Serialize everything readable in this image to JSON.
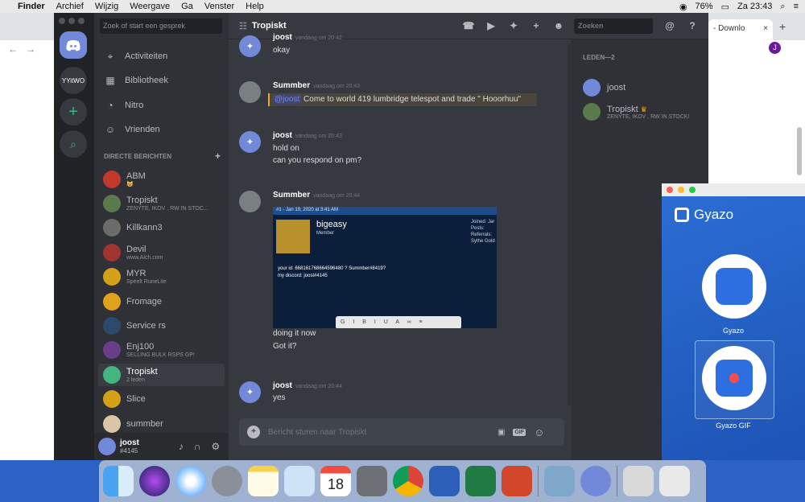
{
  "menubar": {
    "app": "Finder",
    "items": [
      "Archief",
      "Wijzig",
      "Weergave",
      "Ga",
      "Venster",
      "Help"
    ],
    "battery": "76%",
    "clock": "Za 23:43"
  },
  "browser": {
    "tab_label": "- Downlo",
    "new_tab": "+",
    "close": "×",
    "profile_initial": "J"
  },
  "discord": {
    "server_list": {
      "yvtwo_label": "YYitWO",
      "add": "+"
    },
    "search_placeholder": "Zoek of start een gesprek",
    "nav": [
      "Activiteiten",
      "Bibliotheek",
      "Nitro",
      "Vrienden"
    ],
    "dm_header": "DIRECTE BERICHTEN",
    "dm_add": "+",
    "dms": [
      {
        "name": "ABM",
        "sub": "😺",
        "color": "#c0392b"
      },
      {
        "name": "Tropiskt",
        "sub": "ZENYTE, IKOV , RW IN STOC...",
        "color": "#5a7a4e"
      },
      {
        "name": "Killkann3",
        "sub": "",
        "color": "#6b6b6b"
      },
      {
        "name": "Devil",
        "sub": "www.Alch.com",
        "color": "#a0342e"
      },
      {
        "name": "MYR",
        "sub": "Speelt RuneLite",
        "color": "#d4a017"
      },
      {
        "name": "Fromage",
        "sub": "",
        "color": "#e0a11b"
      },
      {
        "name": "Service rs",
        "sub": "",
        "color": "#2d4a6b"
      },
      {
        "name": "Enj100",
        "sub": "SELLING BULK RSPS GP!",
        "color": "#6a3d8a"
      },
      {
        "name": "Tropiskt",
        "sub": "2 leden",
        "color": "#43b581",
        "selected": true
      },
      {
        "name": "Slice",
        "sub": "",
        "color": "#d4a017"
      },
      {
        "name": "summber",
        "sub": "",
        "color": "#d9c6a5"
      }
    ],
    "user": {
      "name": "joost",
      "tag": "#4145"
    },
    "channel": {
      "title": "Tropiskt",
      "search_placeholder": "Zoeken"
    },
    "messages": [
      {
        "author": "joost",
        "time": "vandaag om 20:42",
        "lines": [
          "okay"
        ]
      },
      {
        "author": "Summber",
        "time": "vandaag om 20:43",
        "mention": "@joost",
        "mention_text": " Come to world 419 lumbridge telespot and trade \" Hooorhuu\""
      },
      {
        "author": "joost",
        "time": "vandaag om 20:43",
        "lines": [
          "hold on",
          "can you respond on pm?"
        ]
      },
      {
        "author": "Summber",
        "time": "vandaag om 20:44",
        "after_image": [
          "doing it now",
          "Got it?"
        ]
      },
      {
        "author": "joost",
        "time": "vandaag om 20:44",
        "lines": [
          "yes"
        ]
      }
    ],
    "embed": {
      "post_meta": "#1 - Jan 19, 2020 at 3:41 AM",
      "username": "bigeasy",
      "role": "Member",
      "stats": [
        "Joined: Jar",
        "Posts:",
        "Referrals:",
        "Sythe Gold"
      ],
      "line1": "your id: 668161768664596480 ? Summber#8419?",
      "line2": "my discord: joost#4145"
    },
    "compose_placeholder": "Bericht sturen naar Tropiskt",
    "compose_gif": "GIF",
    "members_header": "LEDEN—2",
    "members": [
      {
        "name": "joost",
        "sub": ""
      },
      {
        "name": "Tropiskt",
        "sub": "ZENYTE, IKOV , RW IN STOCK!"
      }
    ]
  },
  "gyazo": {
    "title": "Gyazo",
    "apps": [
      "Gyazo",
      "Gyazo GIF"
    ]
  },
  "dock": {
    "apps": [
      "finder-icon",
      "siri-icon",
      "safari-icon",
      "launchpad-icon",
      "notes-icon",
      "mail-icon",
      "calendar-icon",
      "system-preferences-icon",
      "chrome-icon",
      "word-icon",
      "excel-icon",
      "powerpoint-icon",
      "preview-icon",
      "discord-icon",
      "downloads-icon",
      "trash-icon"
    ],
    "calendar_day": "18"
  }
}
